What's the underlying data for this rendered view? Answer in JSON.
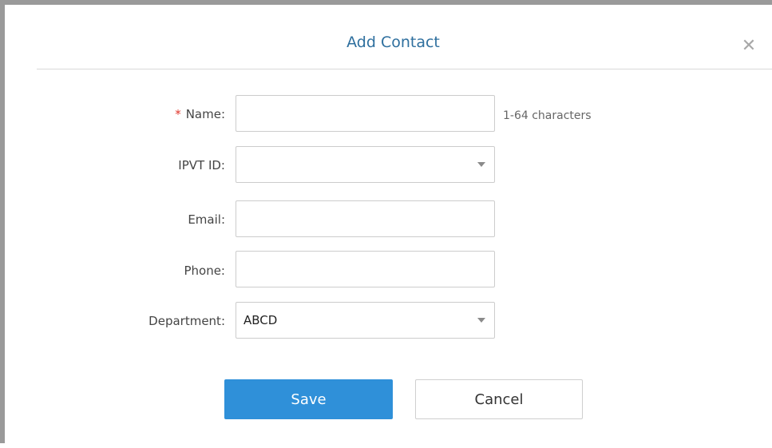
{
  "dialog": {
    "title": "Add Contact",
    "close_icon": "close-icon"
  },
  "form": {
    "name": {
      "label": "Name:",
      "required_mark": "*",
      "value": "",
      "hint": "1-64 characters"
    },
    "ipvt_id": {
      "label": "IPVT ID:",
      "value": ""
    },
    "email": {
      "label": "Email:",
      "value": ""
    },
    "phone": {
      "label": "Phone:",
      "value": ""
    },
    "department": {
      "label": "Department:",
      "value": "ABCD"
    }
  },
  "buttons": {
    "save_label": "Save",
    "cancel_label": "Cancel"
  },
  "colors": {
    "title": "#2e6f9e",
    "primary": "#2f90d9",
    "required": "#e0352b"
  }
}
